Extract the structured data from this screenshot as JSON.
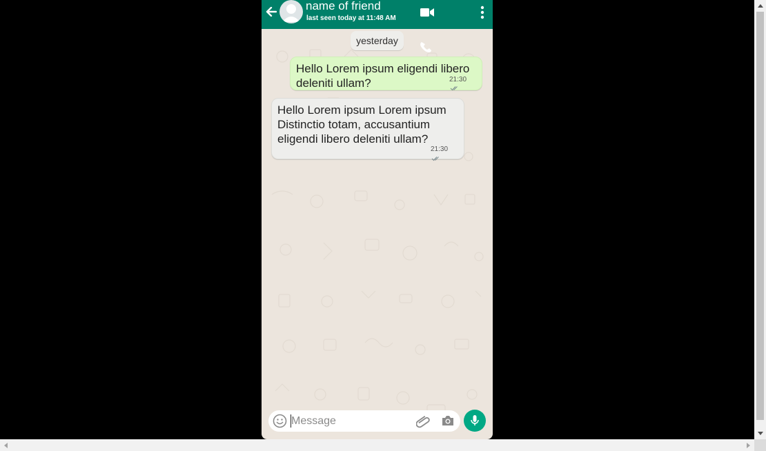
{
  "header": {
    "contact_name": "name of friend",
    "last_seen": "last seen today at 11:48 AM",
    "bg_color": "#008069"
  },
  "chat": {
    "date_label": "yesterday",
    "messages": [
      {
        "direction": "outgoing",
        "text": "Hello Lorem ipsum eligendi libero deleniti ullam?",
        "time": "21:30",
        "status": "read",
        "bg_color": "#dcf8c6"
      },
      {
        "direction": "incoming",
        "text": "Hello Lorem ipsum Lorem ipsum Distinctio totam, accusantium eligendi libero deleniti ullam?",
        "time": "21:30",
        "status": "read",
        "bg_color": "#eeeeec"
      }
    ]
  },
  "composer": {
    "placeholder": "Message",
    "value": ""
  },
  "icons": {
    "back": "arrow-left-icon",
    "avatar": "avatar-placeholder-icon",
    "video": "video-call-icon",
    "more": "more-vertical-icon",
    "call": "phone-icon",
    "emoji": "emoji-icon",
    "attach": "paperclip-icon",
    "camera": "camera-icon",
    "mic": "microphone-icon"
  },
  "colors": {
    "accent": "#00a884",
    "chat_bg": "#ece5dd"
  }
}
